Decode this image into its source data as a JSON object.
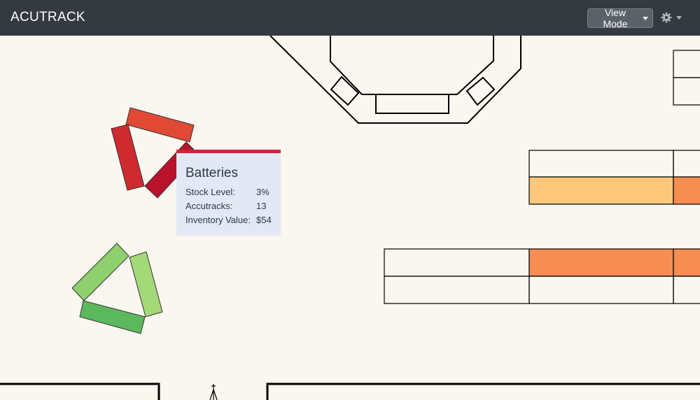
{
  "navbar": {
    "brand": "ACUTRACK",
    "view_mode_label": "View Mode",
    "settings_icon": "gear-icon"
  },
  "colors": {
    "navbar_bg": "#343a40",
    "floor_bg": "#faf6f0",
    "shelf_light_orange": "#fdc87a",
    "shelf_orange": "#f68d51",
    "rack_red": "#e04a35",
    "rack_dark_red": "#b8132b",
    "rack_green": "#8fd06e",
    "tooltip_accent": "#c9283a"
  },
  "tooltip": {
    "title": "Batteries",
    "rows": [
      {
        "label": "Stock Level:",
        "value": "3%"
      },
      {
        "label": "Accutracks:",
        "value": "13"
      },
      {
        "label": "Inventory Value:",
        "value": "$54"
      }
    ]
  }
}
